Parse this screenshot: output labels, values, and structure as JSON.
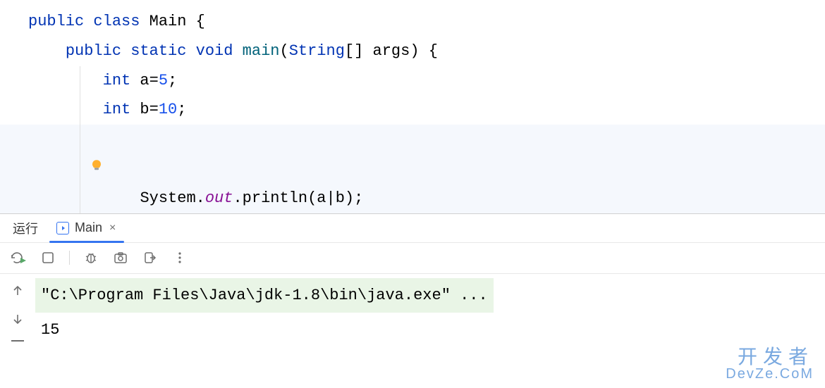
{
  "code": {
    "l1": {
      "public": "public",
      "class": "class",
      "name": "Main",
      "brace": " {"
    },
    "l2": {
      "public": "public",
      "static": "static",
      "void": "void",
      "main": "main",
      "params_open": "(",
      "type": "String",
      "brackets": "[]",
      "arg": " args",
      "params_close": ")",
      "brace": " {"
    },
    "l3": {
      "int": "int",
      "var": " a",
      "eq": "=",
      "val": "5",
      "semi": ";"
    },
    "l4": {
      "int": "int",
      "var": " b",
      "eq": "=",
      "val": "10",
      "semi": ";"
    },
    "l5": {
      "sys": "System",
      "dot1": ".",
      "out": "out",
      "dot2": ".",
      "println": "println",
      "open": "(",
      "a": "a",
      "pipe": "|",
      "b": "b",
      "close": ")",
      "semi": ";"
    }
  },
  "run_header": {
    "label": "运行",
    "tab_name": "Main",
    "close": "×"
  },
  "console": {
    "command": "\"C:\\Program Files\\Java\\jdk-1.8\\bin\\java.exe\" ...",
    "output": "15"
  },
  "watermark": {
    "top": "开发者",
    "bottom": "DevZe.CoM"
  }
}
